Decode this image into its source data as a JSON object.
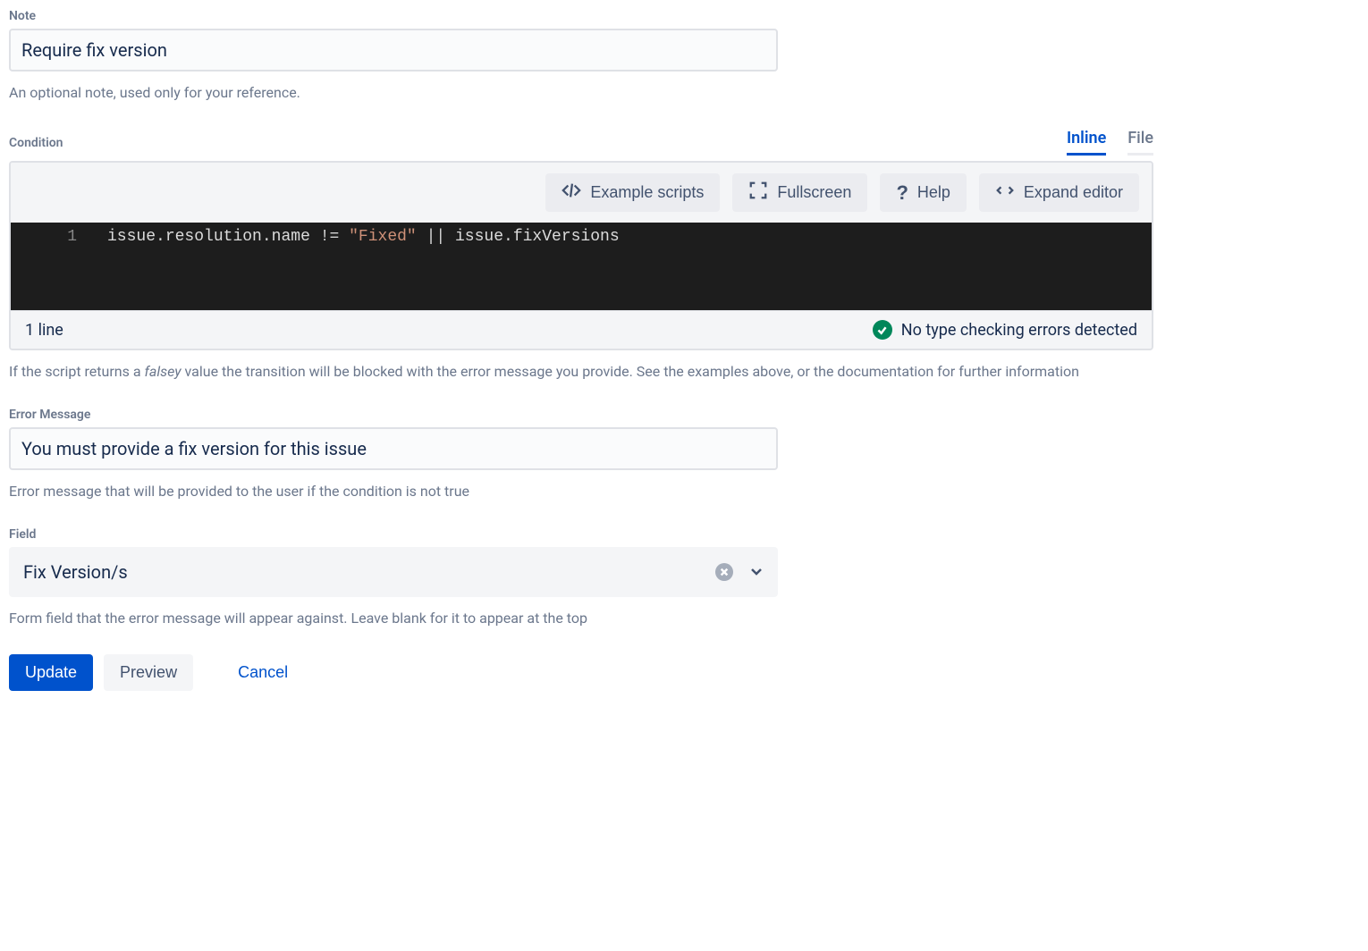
{
  "note": {
    "label": "Note",
    "value": "Require fix version",
    "help": "An optional note, used only for your reference."
  },
  "condition": {
    "label": "Condition",
    "tabs": {
      "inline": "Inline",
      "file": "File"
    },
    "toolbar": {
      "example": "Example scripts",
      "fullscreen": "Fullscreen",
      "help": "Help",
      "expand": "Expand editor"
    },
    "code": {
      "line_number": "1",
      "text": "issue.resolution.name != \"Fixed\" || issue.fixVersions"
    },
    "status": {
      "lines": "1 line",
      "message": "No type checking errors detected"
    },
    "help_prefix": "If the script returns a ",
    "help_em": "falsey",
    "help_suffix": " value the transition will be blocked with the error message you provide. See the examples above, or the documentation for further information"
  },
  "error_message": {
    "label": "Error Message",
    "value": "You must provide a fix version for this issue",
    "help": "Error message that will be provided to the user if the condition is not true"
  },
  "field": {
    "label": "Field",
    "value": "Fix Version/s",
    "help": "Form field that the error message will appear against. Leave blank for it to appear at the top"
  },
  "actions": {
    "update": "Update",
    "preview": "Preview",
    "cancel": "Cancel"
  }
}
